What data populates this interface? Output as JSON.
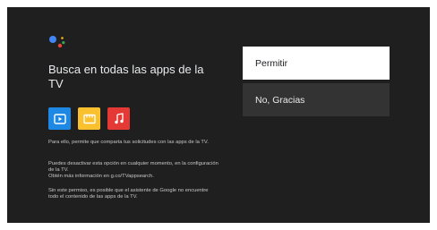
{
  "screen": {
    "title": "Busca en todas las apps de la TV",
    "apps": [
      {
        "icon": "play-video-icon",
        "color": "#1e88e5"
      },
      {
        "icon": "clapperboard-icon",
        "color": "#fbc02d"
      },
      {
        "icon": "music-note-icon",
        "color": "#e53935"
      }
    ],
    "description": {
      "paragraph1": "Para ello, permite que comparta tus solicitudes con las apps de la TV.",
      "paragraph2_line1": "Puedes desactivar esta opción en cualquier momento, en la configuración de la TV.",
      "paragraph2_line2": "Obtén más información en g.co/TVappsearch.",
      "paragraph3": "Sin este permiso, es posible que el asistente de Google no encuentre todo el contenido de las apps de la TV."
    }
  },
  "options": {
    "allow_label": "Permitir",
    "decline_label": "No, Gracias"
  }
}
